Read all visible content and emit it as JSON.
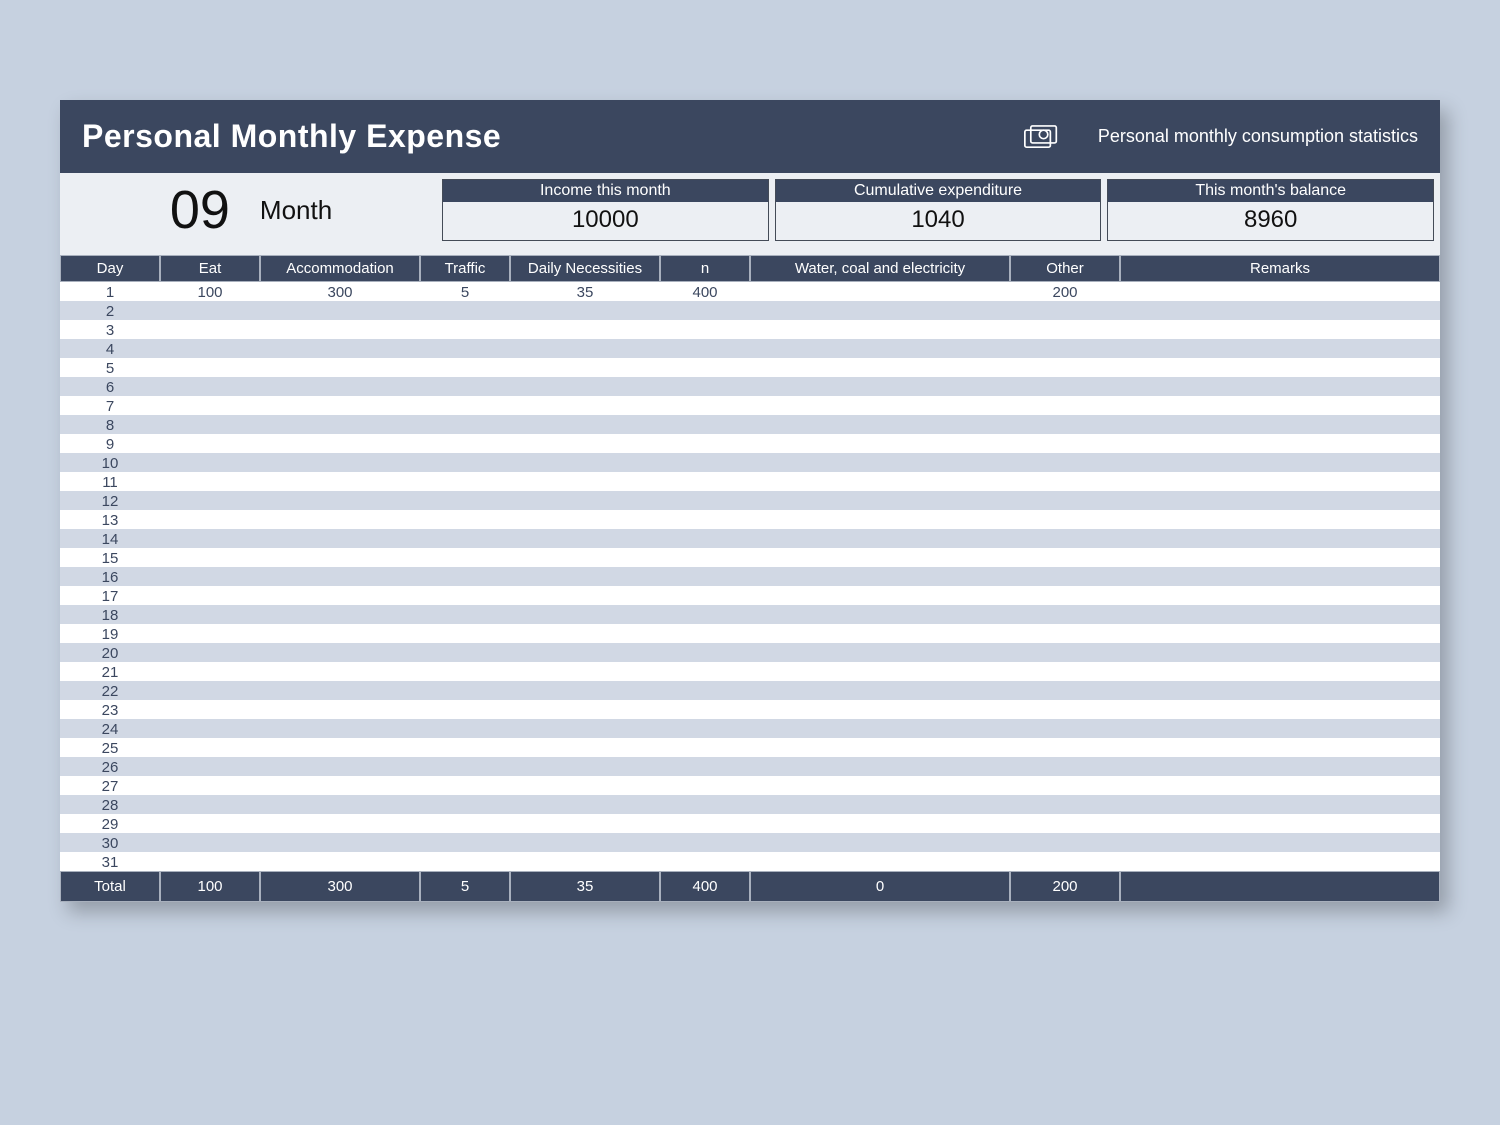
{
  "header": {
    "title": "Personal Monthly Expense",
    "subtitle": "Personal monthly consumption statistics"
  },
  "summary": {
    "month_number": "09",
    "month_label": "Month",
    "stats": [
      {
        "label": "Income this month",
        "value": "10000"
      },
      {
        "label": "Cumulative expenditure",
        "value": "1040"
      },
      {
        "label": "This month's balance",
        "value": "8960"
      }
    ]
  },
  "columns": [
    "Day",
    "Eat",
    "Accommodation",
    "Traffic",
    "Daily Necessities",
    "n",
    "Water, coal and electricity",
    "Other",
    "Remarks"
  ],
  "rows": [
    {
      "day": "1",
      "eat": "100",
      "acc": "300",
      "traf": "5",
      "dn": "35",
      "n": "400",
      "wce": "",
      "oth": "200",
      "rem": ""
    },
    {
      "day": "2",
      "eat": "",
      "acc": "",
      "traf": "",
      "dn": "",
      "n": "",
      "wce": "",
      "oth": "",
      "rem": ""
    },
    {
      "day": "3",
      "eat": "",
      "acc": "",
      "traf": "",
      "dn": "",
      "n": "",
      "wce": "",
      "oth": "",
      "rem": ""
    },
    {
      "day": "4",
      "eat": "",
      "acc": "",
      "traf": "",
      "dn": "",
      "n": "",
      "wce": "",
      "oth": "",
      "rem": ""
    },
    {
      "day": "5",
      "eat": "",
      "acc": "",
      "traf": "",
      "dn": "",
      "n": "",
      "wce": "",
      "oth": "",
      "rem": ""
    },
    {
      "day": "6",
      "eat": "",
      "acc": "",
      "traf": "",
      "dn": "",
      "n": "",
      "wce": "",
      "oth": "",
      "rem": ""
    },
    {
      "day": "7",
      "eat": "",
      "acc": "",
      "traf": "",
      "dn": "",
      "n": "",
      "wce": "",
      "oth": "",
      "rem": ""
    },
    {
      "day": "8",
      "eat": "",
      "acc": "",
      "traf": "",
      "dn": "",
      "n": "",
      "wce": "",
      "oth": "",
      "rem": ""
    },
    {
      "day": "9",
      "eat": "",
      "acc": "",
      "traf": "",
      "dn": "",
      "n": "",
      "wce": "",
      "oth": "",
      "rem": ""
    },
    {
      "day": "10",
      "eat": "",
      "acc": "",
      "traf": "",
      "dn": "",
      "n": "",
      "wce": "",
      "oth": "",
      "rem": ""
    },
    {
      "day": "11",
      "eat": "",
      "acc": "",
      "traf": "",
      "dn": "",
      "n": "",
      "wce": "",
      "oth": "",
      "rem": ""
    },
    {
      "day": "12",
      "eat": "",
      "acc": "",
      "traf": "",
      "dn": "",
      "n": "",
      "wce": "",
      "oth": "",
      "rem": ""
    },
    {
      "day": "13",
      "eat": "",
      "acc": "",
      "traf": "",
      "dn": "",
      "n": "",
      "wce": "",
      "oth": "",
      "rem": ""
    },
    {
      "day": "14",
      "eat": "",
      "acc": "",
      "traf": "",
      "dn": "",
      "n": "",
      "wce": "",
      "oth": "",
      "rem": ""
    },
    {
      "day": "15",
      "eat": "",
      "acc": "",
      "traf": "",
      "dn": "",
      "n": "",
      "wce": "",
      "oth": "",
      "rem": ""
    },
    {
      "day": "16",
      "eat": "",
      "acc": "",
      "traf": "",
      "dn": "",
      "n": "",
      "wce": "",
      "oth": "",
      "rem": ""
    },
    {
      "day": "17",
      "eat": "",
      "acc": "",
      "traf": "",
      "dn": "",
      "n": "",
      "wce": "",
      "oth": "",
      "rem": ""
    },
    {
      "day": "18",
      "eat": "",
      "acc": "",
      "traf": "",
      "dn": "",
      "n": "",
      "wce": "",
      "oth": "",
      "rem": ""
    },
    {
      "day": "19",
      "eat": "",
      "acc": "",
      "traf": "",
      "dn": "",
      "n": "",
      "wce": "",
      "oth": "",
      "rem": ""
    },
    {
      "day": "20",
      "eat": "",
      "acc": "",
      "traf": "",
      "dn": "",
      "n": "",
      "wce": "",
      "oth": "",
      "rem": ""
    },
    {
      "day": "21",
      "eat": "",
      "acc": "",
      "traf": "",
      "dn": "",
      "n": "",
      "wce": "",
      "oth": "",
      "rem": ""
    },
    {
      "day": "22",
      "eat": "",
      "acc": "",
      "traf": "",
      "dn": "",
      "n": "",
      "wce": "",
      "oth": "",
      "rem": ""
    },
    {
      "day": "23",
      "eat": "",
      "acc": "",
      "traf": "",
      "dn": "",
      "n": "",
      "wce": "",
      "oth": "",
      "rem": ""
    },
    {
      "day": "24",
      "eat": "",
      "acc": "",
      "traf": "",
      "dn": "",
      "n": "",
      "wce": "",
      "oth": "",
      "rem": ""
    },
    {
      "day": "25",
      "eat": "",
      "acc": "",
      "traf": "",
      "dn": "",
      "n": "",
      "wce": "",
      "oth": "",
      "rem": ""
    },
    {
      "day": "26",
      "eat": "",
      "acc": "",
      "traf": "",
      "dn": "",
      "n": "",
      "wce": "",
      "oth": "",
      "rem": ""
    },
    {
      "day": "27",
      "eat": "",
      "acc": "",
      "traf": "",
      "dn": "",
      "n": "",
      "wce": "",
      "oth": "",
      "rem": ""
    },
    {
      "day": "28",
      "eat": "",
      "acc": "",
      "traf": "",
      "dn": "",
      "n": "",
      "wce": "",
      "oth": "",
      "rem": ""
    },
    {
      "day": "29",
      "eat": "",
      "acc": "",
      "traf": "",
      "dn": "",
      "n": "",
      "wce": "",
      "oth": "",
      "rem": ""
    },
    {
      "day": "30",
      "eat": "",
      "acc": "",
      "traf": "",
      "dn": "",
      "n": "",
      "wce": "",
      "oth": "",
      "rem": ""
    },
    {
      "day": "31",
      "eat": "",
      "acc": "",
      "traf": "",
      "dn": "",
      "n": "",
      "wce": "",
      "oth": "",
      "rem": ""
    }
  ],
  "totals": {
    "label": "Total",
    "eat": "100",
    "acc": "300",
    "traf": "5",
    "dn": "35",
    "n": "400",
    "wce": "0",
    "oth": "200",
    "rem": ""
  }
}
